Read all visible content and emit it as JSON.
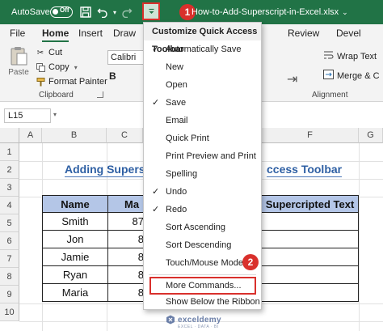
{
  "titlebar": {
    "autosave_label": "AutoSave",
    "autosave_state": "Off",
    "file_title": "How-to-Add-Superscript-in-Excel.xlsx",
    "accent": "#217346"
  },
  "callouts": {
    "step1": "1",
    "step2": "2",
    "color": "#d9302c"
  },
  "tabs": [
    "File",
    "Home",
    "Insert",
    "Draw",
    "Review",
    "Devel"
  ],
  "active_tab": "Home",
  "ribbon": {
    "paste_label": "Paste",
    "cut_label": "Cut",
    "copy_label": "Copy",
    "format_painter_label": "Format Painter",
    "clipboard_group": "Clipboard",
    "font_name": "Calibri",
    "bold_label": "B",
    "wrap_text_label": "Wrap Text",
    "merge_label": "Merge & C",
    "alignment_group": "Alignment"
  },
  "formula_bar": {
    "name_box": "L15"
  },
  "grid": {
    "columns": [
      "A",
      "B",
      "C",
      "D",
      "E",
      "F",
      "G"
    ],
    "rows": [
      "1",
      "2",
      "3",
      "4",
      "5",
      "6",
      "7",
      "8",
      "9",
      "10"
    ],
    "title_left": "Adding Superscr",
    "title_right": "ccess Toolbar",
    "table_headers": {
      "name": "Name",
      "mid": "Ma",
      "right": "Supercripted Text"
    },
    "names": [
      "Smith",
      "Jon",
      "Jamie",
      "Ryan",
      "Maria"
    ],
    "partial_values": [
      "87",
      "8",
      "8",
      "8",
      "8"
    ]
  },
  "menu": {
    "header": "Customize Quick Access Toolbar",
    "items": [
      {
        "label": "Automatically Save",
        "checked": true
      },
      {
        "label": "New",
        "checked": false
      },
      {
        "label": "Open",
        "checked": false
      },
      {
        "label": "Save",
        "checked": true
      },
      {
        "label": "Email",
        "checked": false
      },
      {
        "label": "Quick Print",
        "checked": false
      },
      {
        "label": "Print Preview and Print",
        "checked": false
      },
      {
        "label": "Spelling",
        "checked": false
      },
      {
        "label": "Undo",
        "checked": true
      },
      {
        "label": "Redo",
        "checked": true
      },
      {
        "label": "Sort Ascending",
        "checked": false
      },
      {
        "label": "Sort Descending",
        "checked": false
      },
      {
        "label": "Touch/Mouse Mode",
        "checked": false
      },
      {
        "label": "More Commands...",
        "checked": false
      },
      {
        "label": "Show Below the Ribbon",
        "checked": false
      }
    ],
    "check_glyph": "✓"
  },
  "watermark": {
    "name": "exceldemy",
    "tagline": "EXCEL · DATA · BI"
  }
}
